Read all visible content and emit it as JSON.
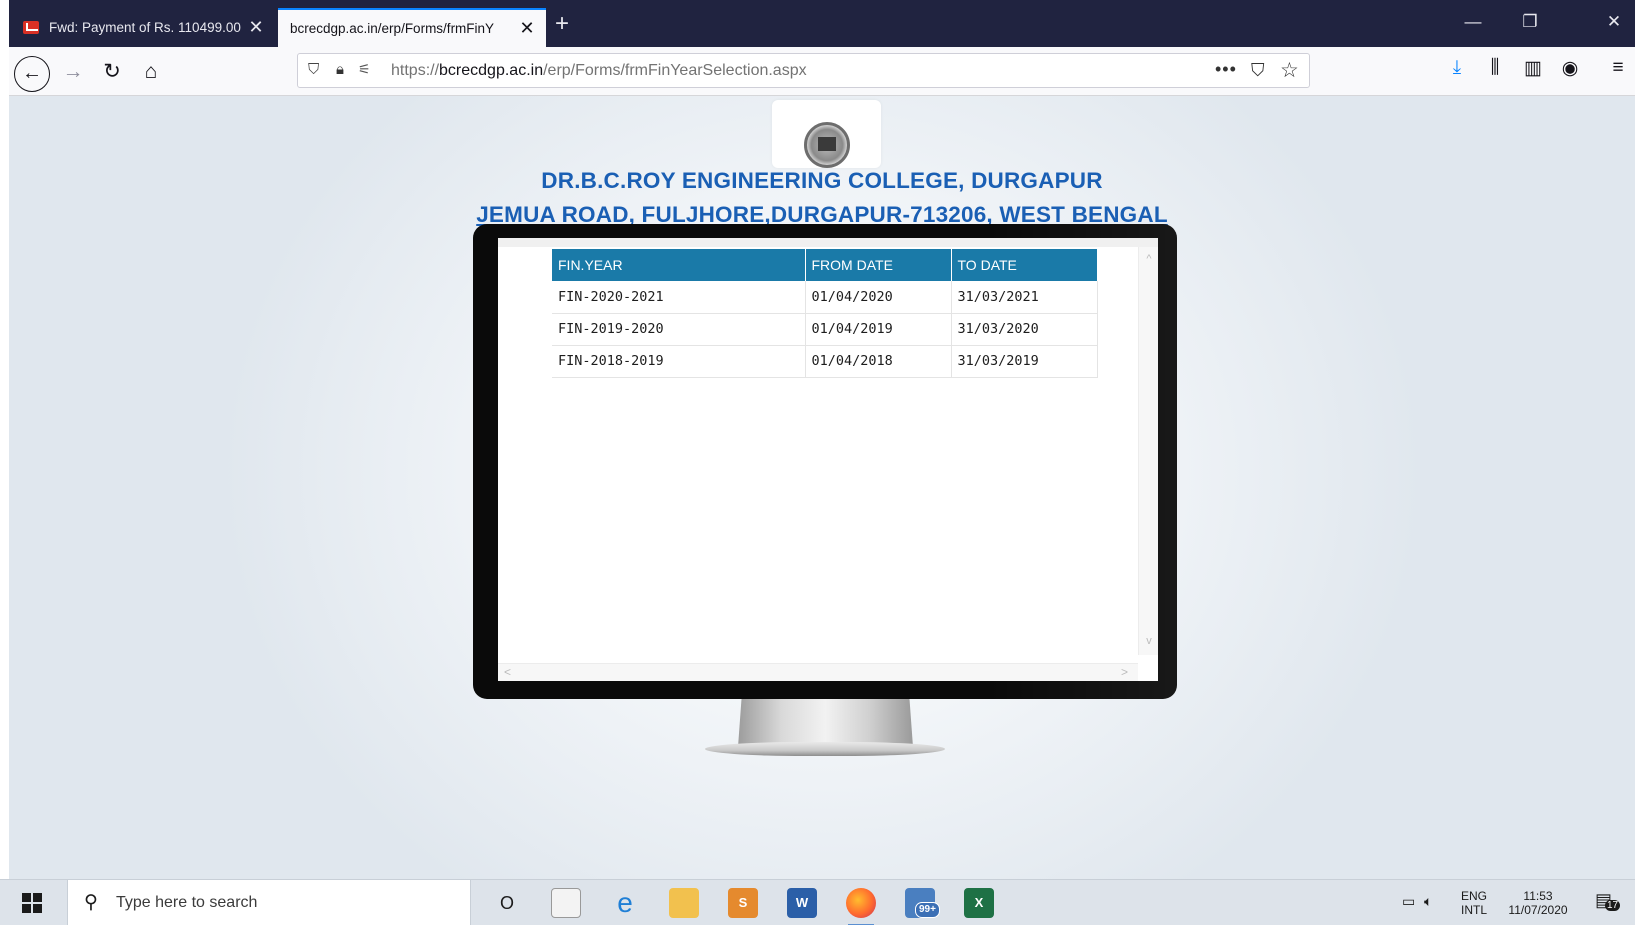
{
  "browser": {
    "tabs": [
      {
        "title": "Fwd: Payment of Rs. 110499.00",
        "close": "✕",
        "active": false
      },
      {
        "title": "bcrecdgp.ac.in/erp/Forms/frmFinY",
        "close": "✕",
        "active": true
      }
    ],
    "new_tab": "+",
    "window_controls": {
      "minimize": "—",
      "restore": "❐",
      "close": "✕"
    },
    "nav": {
      "back": "←",
      "forward": "→",
      "reload": "↻",
      "home": "⌂"
    },
    "url": {
      "prefix": "https://",
      "domain": "bcrecdgp.ac.in",
      "path": "/erp/Forms/frmFinYearSelection.aspx"
    },
    "urlbar_icons": {
      "more": "•••",
      "pocket": "⛉",
      "bookmark": "☆"
    },
    "toolbar_icons": {
      "downloads": "⤓",
      "library": "⫼",
      "sidebar": "▥",
      "account": "◉",
      "menu": "≡"
    }
  },
  "page": {
    "college_name": "DR.B.C.ROY ENGINEERING COLLEGE, DURGAPUR",
    "college_address": "JEMUA ROAD, FULJHORE,DURGAPUR-713206, WEST BENGAL",
    "table": {
      "headers": [
        "FIN.YEAR",
        "FROM DATE",
        "TO DATE"
      ],
      "rows": [
        [
          "FIN-2020-2021",
          "01/04/2020",
          "31/03/2021"
        ],
        [
          "FIN-2019-2020",
          "01/04/2019",
          "31/03/2020"
        ],
        [
          "FIN-2018-2019",
          "01/04/2018",
          "31/03/2019"
        ]
      ]
    },
    "scroll_arrows": {
      "up": "^",
      "down": "v",
      "left": "<",
      "right": ">"
    }
  },
  "taskbar": {
    "search_placeholder": "Type here to search",
    "cortana": "O",
    "app_labels": {
      "powerpoint": "S",
      "word": "W",
      "excel": "X",
      "mail_badge": "99+"
    },
    "tray": {
      "lang_top": "ENG",
      "lang_bottom": "INTL",
      "time": "11:53",
      "date": "11/07/2020",
      "notifications": "17"
    }
  }
}
